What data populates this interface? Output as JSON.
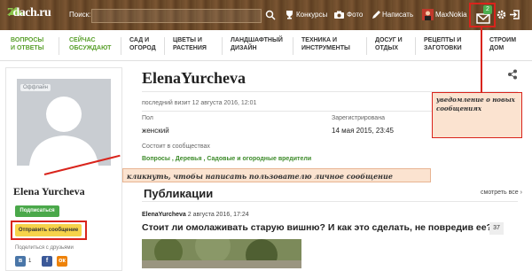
{
  "topbar": {
    "logo_text_num": "7",
    "logo_text_rest": "dach.ru",
    "search_label": "Поиск:",
    "contests": "Конкурсы",
    "photo": "Фото",
    "write": "Написать",
    "username": "MaxNokia",
    "mail_badge": "2"
  },
  "nav": [
    {
      "line1": "Вопросы",
      "line2": "и ответы"
    },
    {
      "line1": "Сейчас",
      "line2": "обсуждают"
    },
    {
      "line1": "Сад и",
      "line2": "огород"
    },
    {
      "line1": "Цветы и",
      "line2": "растения"
    },
    {
      "line1": "Ландшафтный",
      "line2": "дизайн"
    },
    {
      "line1": "Техника и",
      "line2": "инструменты"
    },
    {
      "line1": "Досуг и",
      "line2": "отдых"
    },
    {
      "line1": "Рецепты и",
      "line2": "заготовки"
    },
    {
      "line1": "Строим",
      "line2": "дом"
    }
  ],
  "sidebar": {
    "status": "Оффлайн",
    "name": "Elena Yurcheva",
    "subscribe": "Подписаться",
    "send_message": "Отправить сообщение",
    "share_label": "Поделиться с друзьями",
    "vk_count": "1"
  },
  "profile": {
    "title": "ElenaYurcheva",
    "last_visit": "последний визит 12 августа 2016, 12:01",
    "gender_label": "Пол",
    "gender_value": "женский",
    "registered_label": "Зарегистрирована",
    "registered_value": "14 мая 2015, 23:45",
    "communities_label": "Состоит в сообществах",
    "communities": "Вопросы , Деревья , Садовые и огородные вредители"
  },
  "callouts": {
    "notify": "уведомление о новых сообщениях",
    "send": "кликнуть, чтобы написать пользователю личное сообщение"
  },
  "publications": {
    "title": "Публикации",
    "see_all": "смотреть все",
    "post_author": "ElenaYurcheva",
    "post_date": "2 августа 2016, 17:24",
    "post_title": "Стоит ли омолаживать старую вишню? И как это сделать, не повредив ее?",
    "comments": "37"
  },
  "colors": {
    "green": "#5aa02c",
    "annotation_red": "#d9241c",
    "callout_bg": "#fbe3d0",
    "button_yellow": "#f6d34a"
  }
}
